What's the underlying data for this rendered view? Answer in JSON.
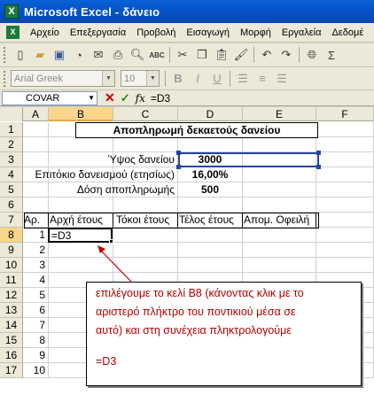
{
  "window": {
    "title": "Microsoft Excel - δάνειο"
  },
  "menu": [
    "Αρχείο",
    "Επεξεργασία",
    "Προβολή",
    "Εισαγωγή",
    "Μορφή",
    "Εργαλεία",
    "Δεδομέ"
  ],
  "toolbar": {
    "font_name": "Arial Greek",
    "font_size": "10",
    "icons": [
      "new-icon",
      "open-icon",
      "save-icon",
      "permission-icon",
      "email-icon",
      "print-icon",
      "print-preview-icon",
      "spelling-icon",
      "cut-icon",
      "copy-icon",
      "paste-icon",
      "format-painter-icon",
      "undo-icon",
      "redo-icon",
      "hyperlink-icon",
      "autosum-icon"
    ],
    "format_icons": [
      "bold-icon",
      "italic-icon",
      "underline-icon",
      "align-left-icon",
      "center-icon",
      "align-right-icon"
    ]
  },
  "formula_bar": {
    "name_box": "COVAR",
    "content": "=D3"
  },
  "columns": [
    "A",
    "B",
    "C",
    "D",
    "E",
    "F"
  ],
  "rows": [
    "1",
    "2",
    "3",
    "4",
    "5",
    "6",
    "7",
    "8",
    "9",
    "10",
    "11",
    "12",
    "13",
    "14",
    "15",
    "16",
    "17"
  ],
  "sheet": {
    "title": "Αποπληρωμή δεκαετούς δανείου",
    "labels": [
      "Ύψος δανείου",
      "Επιτόκιο δανεισμού (ετησίως)",
      "Δόση αποπληρωμής"
    ],
    "values": [
      "3000",
      "16,00%",
      "500"
    ],
    "headers": [
      "Αρ.",
      "Αρχή έτους",
      "Τόκοι έτους",
      "Τέλος έτους",
      "Απομ. Οφειλή"
    ],
    "numbers": [
      "1",
      "2",
      "3",
      "4",
      "5",
      "6",
      "7",
      "8",
      "9",
      "10"
    ],
    "active_cell_text": "=D3"
  },
  "callout": {
    "line1": "επιλέγουμε το κελί Β8 (κάνοντας κλικ με το",
    "line2": "αριστερό πλήκτρο του ποντικιού μέσα σε",
    "line3": "αυτό) και στη συνέχεια πληκτρολογούμε",
    "code": "=D3"
  }
}
